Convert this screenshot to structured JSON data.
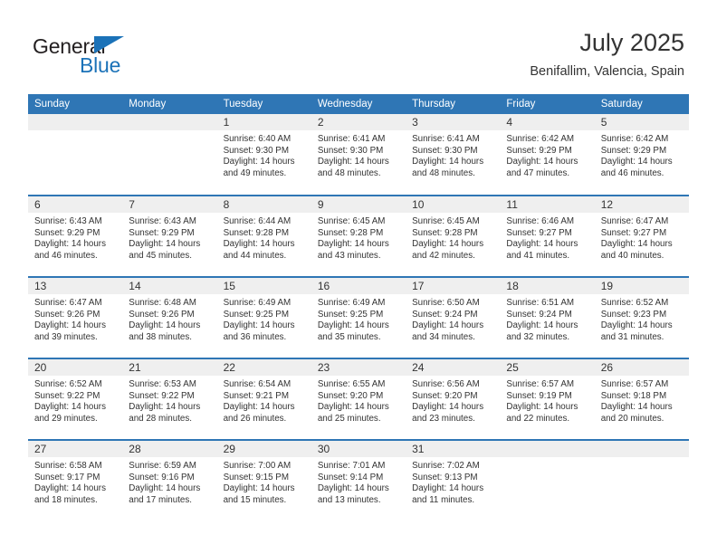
{
  "brand": {
    "word_one": "General",
    "word_two": "Blue",
    "triangle_color": "#1b72b8",
    "text_color": "#231f20"
  },
  "header": {
    "title": "July 2025",
    "subtitle": "Benifallim, Valencia, Spain"
  },
  "theme": {
    "header_blue": "#2f76b5",
    "daynum_band": "#efefef",
    "text": "#333333",
    "cell_background": "#ffffff"
  },
  "labels": {
    "sunrise_prefix": "Sunrise:",
    "sunset_prefix": "Sunset:",
    "daylight_prefix": "Daylight:"
  },
  "weekdays": [
    "Sunday",
    "Monday",
    "Tuesday",
    "Wednesday",
    "Thursday",
    "Friday",
    "Saturday"
  ],
  "weeks": [
    [
      {
        "day": "",
        "sunrise": "",
        "sunset": "",
        "daylight_a": "",
        "daylight_b": "",
        "empty": true
      },
      {
        "day": "",
        "sunrise": "",
        "sunset": "",
        "daylight_a": "",
        "daylight_b": "",
        "empty": true
      },
      {
        "day": "1",
        "sunrise": "Sunrise: 6:40 AM",
        "sunset": "Sunset: 9:30 PM",
        "daylight_a": "Daylight: 14 hours",
        "daylight_b": "and 49 minutes."
      },
      {
        "day": "2",
        "sunrise": "Sunrise: 6:41 AM",
        "sunset": "Sunset: 9:30 PM",
        "daylight_a": "Daylight: 14 hours",
        "daylight_b": "and 48 minutes."
      },
      {
        "day": "3",
        "sunrise": "Sunrise: 6:41 AM",
        "sunset": "Sunset: 9:30 PM",
        "daylight_a": "Daylight: 14 hours",
        "daylight_b": "and 48 minutes."
      },
      {
        "day": "4",
        "sunrise": "Sunrise: 6:42 AM",
        "sunset": "Sunset: 9:29 PM",
        "daylight_a": "Daylight: 14 hours",
        "daylight_b": "and 47 minutes."
      },
      {
        "day": "5",
        "sunrise": "Sunrise: 6:42 AM",
        "sunset": "Sunset: 9:29 PM",
        "daylight_a": "Daylight: 14 hours",
        "daylight_b": "and 46 minutes."
      }
    ],
    [
      {
        "day": "6",
        "sunrise": "Sunrise: 6:43 AM",
        "sunset": "Sunset: 9:29 PM",
        "daylight_a": "Daylight: 14 hours",
        "daylight_b": "and 46 minutes."
      },
      {
        "day": "7",
        "sunrise": "Sunrise: 6:43 AM",
        "sunset": "Sunset: 9:29 PM",
        "daylight_a": "Daylight: 14 hours",
        "daylight_b": "and 45 minutes."
      },
      {
        "day": "8",
        "sunrise": "Sunrise: 6:44 AM",
        "sunset": "Sunset: 9:28 PM",
        "daylight_a": "Daylight: 14 hours",
        "daylight_b": "and 44 minutes."
      },
      {
        "day": "9",
        "sunrise": "Sunrise: 6:45 AM",
        "sunset": "Sunset: 9:28 PM",
        "daylight_a": "Daylight: 14 hours",
        "daylight_b": "and 43 minutes."
      },
      {
        "day": "10",
        "sunrise": "Sunrise: 6:45 AM",
        "sunset": "Sunset: 9:28 PM",
        "daylight_a": "Daylight: 14 hours",
        "daylight_b": "and 42 minutes."
      },
      {
        "day": "11",
        "sunrise": "Sunrise: 6:46 AM",
        "sunset": "Sunset: 9:27 PM",
        "daylight_a": "Daylight: 14 hours",
        "daylight_b": "and 41 minutes."
      },
      {
        "day": "12",
        "sunrise": "Sunrise: 6:47 AM",
        "sunset": "Sunset: 9:27 PM",
        "daylight_a": "Daylight: 14 hours",
        "daylight_b": "and 40 minutes."
      }
    ],
    [
      {
        "day": "13",
        "sunrise": "Sunrise: 6:47 AM",
        "sunset": "Sunset: 9:26 PM",
        "daylight_a": "Daylight: 14 hours",
        "daylight_b": "and 39 minutes."
      },
      {
        "day": "14",
        "sunrise": "Sunrise: 6:48 AM",
        "sunset": "Sunset: 9:26 PM",
        "daylight_a": "Daylight: 14 hours",
        "daylight_b": "and 38 minutes."
      },
      {
        "day": "15",
        "sunrise": "Sunrise: 6:49 AM",
        "sunset": "Sunset: 9:25 PM",
        "daylight_a": "Daylight: 14 hours",
        "daylight_b": "and 36 minutes."
      },
      {
        "day": "16",
        "sunrise": "Sunrise: 6:49 AM",
        "sunset": "Sunset: 9:25 PM",
        "daylight_a": "Daylight: 14 hours",
        "daylight_b": "and 35 minutes."
      },
      {
        "day": "17",
        "sunrise": "Sunrise: 6:50 AM",
        "sunset": "Sunset: 9:24 PM",
        "daylight_a": "Daylight: 14 hours",
        "daylight_b": "and 34 minutes."
      },
      {
        "day": "18",
        "sunrise": "Sunrise: 6:51 AM",
        "sunset": "Sunset: 9:24 PM",
        "daylight_a": "Daylight: 14 hours",
        "daylight_b": "and 32 minutes."
      },
      {
        "day": "19",
        "sunrise": "Sunrise: 6:52 AM",
        "sunset": "Sunset: 9:23 PM",
        "daylight_a": "Daylight: 14 hours",
        "daylight_b": "and 31 minutes."
      }
    ],
    [
      {
        "day": "20",
        "sunrise": "Sunrise: 6:52 AM",
        "sunset": "Sunset: 9:22 PM",
        "daylight_a": "Daylight: 14 hours",
        "daylight_b": "and 29 minutes."
      },
      {
        "day": "21",
        "sunrise": "Sunrise: 6:53 AM",
        "sunset": "Sunset: 9:22 PM",
        "daylight_a": "Daylight: 14 hours",
        "daylight_b": "and 28 minutes."
      },
      {
        "day": "22",
        "sunrise": "Sunrise: 6:54 AM",
        "sunset": "Sunset: 9:21 PM",
        "daylight_a": "Daylight: 14 hours",
        "daylight_b": "and 26 minutes."
      },
      {
        "day": "23",
        "sunrise": "Sunrise: 6:55 AM",
        "sunset": "Sunset: 9:20 PM",
        "daylight_a": "Daylight: 14 hours",
        "daylight_b": "and 25 minutes."
      },
      {
        "day": "24",
        "sunrise": "Sunrise: 6:56 AM",
        "sunset": "Sunset: 9:20 PM",
        "daylight_a": "Daylight: 14 hours",
        "daylight_b": "and 23 minutes."
      },
      {
        "day": "25",
        "sunrise": "Sunrise: 6:57 AM",
        "sunset": "Sunset: 9:19 PM",
        "daylight_a": "Daylight: 14 hours",
        "daylight_b": "and 22 minutes."
      },
      {
        "day": "26",
        "sunrise": "Sunrise: 6:57 AM",
        "sunset": "Sunset: 9:18 PM",
        "daylight_a": "Daylight: 14 hours",
        "daylight_b": "and 20 minutes."
      }
    ],
    [
      {
        "day": "27",
        "sunrise": "Sunrise: 6:58 AM",
        "sunset": "Sunset: 9:17 PM",
        "daylight_a": "Daylight: 14 hours",
        "daylight_b": "and 18 minutes."
      },
      {
        "day": "28",
        "sunrise": "Sunrise: 6:59 AM",
        "sunset": "Sunset: 9:16 PM",
        "daylight_a": "Daylight: 14 hours",
        "daylight_b": "and 17 minutes."
      },
      {
        "day": "29",
        "sunrise": "Sunrise: 7:00 AM",
        "sunset": "Sunset: 9:15 PM",
        "daylight_a": "Daylight: 14 hours",
        "daylight_b": "and 15 minutes."
      },
      {
        "day": "30",
        "sunrise": "Sunrise: 7:01 AM",
        "sunset": "Sunset: 9:14 PM",
        "daylight_a": "Daylight: 14 hours",
        "daylight_b": "and 13 minutes."
      },
      {
        "day": "31",
        "sunrise": "Sunrise: 7:02 AM",
        "sunset": "Sunset: 9:13 PM",
        "daylight_a": "Daylight: 14 hours",
        "daylight_b": "and 11 minutes."
      },
      {
        "day": "",
        "sunrise": "",
        "sunset": "",
        "daylight_a": "",
        "daylight_b": "",
        "empty": true
      },
      {
        "day": "",
        "sunrise": "",
        "sunset": "",
        "daylight_a": "",
        "daylight_b": "",
        "empty": true
      }
    ]
  ]
}
